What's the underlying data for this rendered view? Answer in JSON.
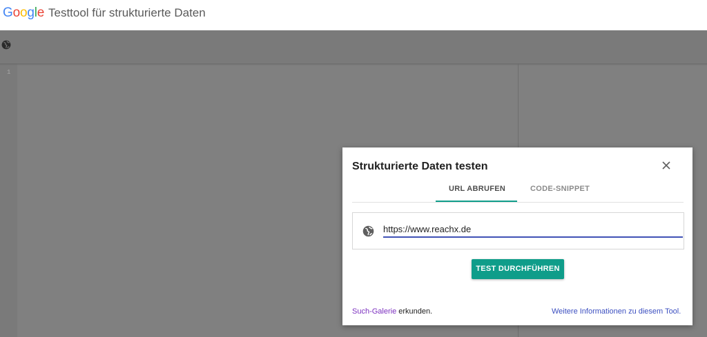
{
  "header": {
    "logo_letters": [
      {
        "char": "G",
        "color": "#4285F4"
      },
      {
        "char": "o",
        "color": "#EA4335"
      },
      {
        "char": "o",
        "color": "#FBBC05"
      },
      {
        "char": "g",
        "color": "#4285F4"
      },
      {
        "char": "l",
        "color": "#34A853"
      },
      {
        "char": "e",
        "color": "#EA4335"
      }
    ],
    "title": "Testtool für strukturierte Daten"
  },
  "toolbar": {
    "icon": "globe-icon"
  },
  "editor": {
    "line_number": "1"
  },
  "dialog": {
    "title": "Strukturierte Daten testen",
    "close_icon": "close-icon",
    "tabs": [
      {
        "label": "URL ABRUFEN",
        "active": true
      },
      {
        "label": "CODE-SNIPPET",
        "active": false
      }
    ],
    "url_field": {
      "icon": "globe-icon",
      "value": "https://www.reachx.de"
    },
    "run_button": "TEST DURCHFÜHREN",
    "footer": {
      "gallery_link": "Such-Galerie",
      "gallery_suffix": " erkunden.",
      "info_link": "Weitere Informationen zu diesem Tool."
    }
  },
  "colors": {
    "accent": "#0f9d8a",
    "input_underline": "#3f51b5",
    "overlay": "#808080"
  }
}
